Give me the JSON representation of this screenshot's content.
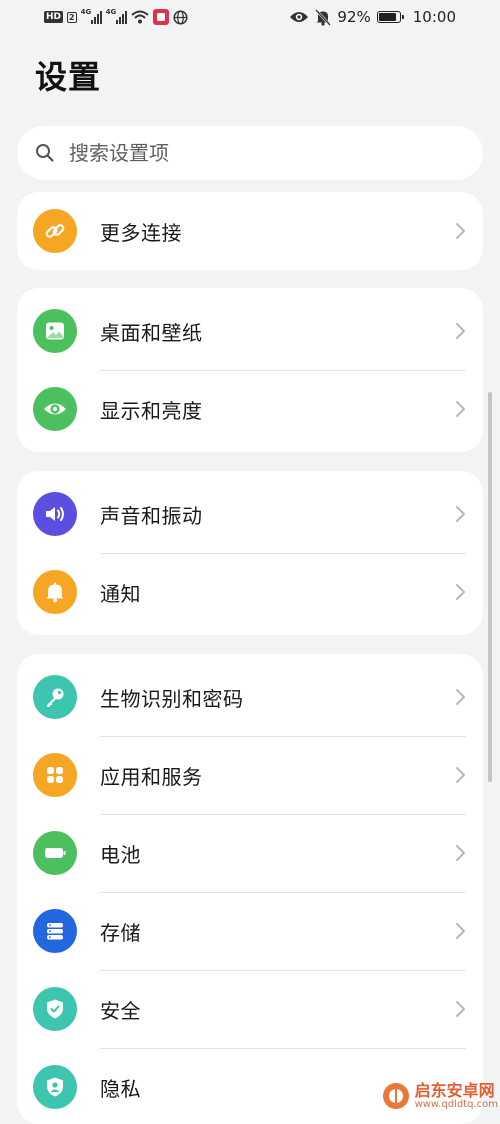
{
  "status_bar": {
    "hd_label": "HD",
    "sim_label": "2",
    "net_label_1": "4G",
    "net_label_2": "4G",
    "battery_percent": "92%",
    "time": "10:00"
  },
  "title": "设置",
  "search": {
    "placeholder": "搜索设置项",
    "value": ""
  },
  "groups": [
    {
      "items": [
        {
          "label": "更多连接",
          "icon": "link-icon",
          "color": "#f5a623"
        }
      ]
    },
    {
      "items": [
        {
          "label": "桌面和壁纸",
          "icon": "wallpaper-icon",
          "color": "#4cbf5e"
        },
        {
          "label": "显示和亮度",
          "icon": "eye-icon",
          "color": "#4cbf5e"
        }
      ]
    },
    {
      "items": [
        {
          "label": "声音和振动",
          "icon": "speaker-icon",
          "color": "#5a4fe0"
        },
        {
          "label": "通知",
          "icon": "bell-icon",
          "color": "#f5a623"
        }
      ]
    },
    {
      "items": [
        {
          "label": "生物识别和密码",
          "icon": "key-icon",
          "color": "#3dc5b0"
        },
        {
          "label": "应用和服务",
          "icon": "apps-icon",
          "color": "#f5a623"
        },
        {
          "label": "电池",
          "icon": "battery-icon",
          "color": "#4cbf5e"
        },
        {
          "label": "存储",
          "icon": "storage-icon",
          "color": "#2266e0"
        },
        {
          "label": "安全",
          "icon": "shield-icon",
          "color": "#3dc5b0"
        },
        {
          "label": "隐私",
          "icon": "privacy-icon",
          "color": "#3dc5b0"
        }
      ]
    }
  ],
  "watermark": {
    "title": "启东安卓网",
    "url": "www.qdldtq.com"
  }
}
